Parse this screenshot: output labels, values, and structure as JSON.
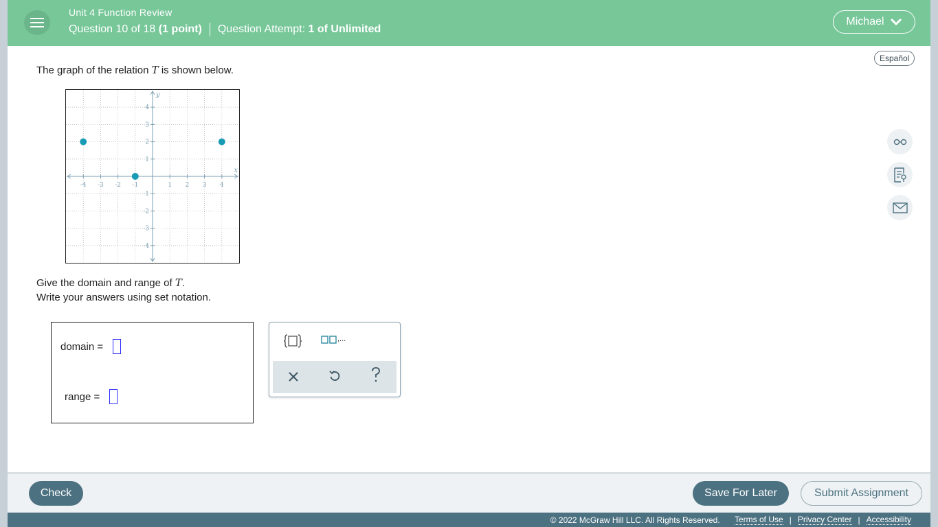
{
  "header": {
    "title": "Unit 4 Function Review",
    "question": "Question 10 of 18",
    "points": "(1 point)",
    "attempt_label": "Question Attempt:",
    "attempt_value": "1 of Unlimited",
    "user": "Michael"
  },
  "language_button": "Español",
  "question": {
    "prefix": "The graph of the relation",
    "variable": "T",
    "suffix": "is shown below.",
    "instruction1_prefix": "Give the domain and range of",
    "instruction1_var": "T",
    "instruction1_end": ".",
    "instruction2": "Write your answers using set notation."
  },
  "graph": {
    "x_axis_label": "x",
    "y_axis_label": "y",
    "range": [
      -5,
      5
    ],
    "ticks": [
      -4,
      -3,
      -2,
      -1,
      1,
      2,
      3,
      4
    ],
    "points": [
      [
        -4,
        2
      ],
      [
        -1,
        0
      ],
      [
        4,
        2
      ]
    ],
    "point_color": "#1a9bb5"
  },
  "answers": {
    "domain_label": "domain =",
    "range_label": "range ="
  },
  "palette": {
    "set_icon": "set-braces-icon",
    "list_icon": "list-elements-icon",
    "list_dots": ",..."
  },
  "side_tools": [
    "glasses-icon",
    "notes-icon",
    "mail-icon"
  ],
  "buttons": {
    "check": "Check",
    "save": "Save For Later",
    "submit": "Submit Assignment"
  },
  "footer": {
    "copyright": "© 2022 McGraw Hill LLC. All Rights Reserved.",
    "terms": "Terms of Use",
    "privacy": "Privacy Center",
    "accessibility": "Accessibility"
  }
}
